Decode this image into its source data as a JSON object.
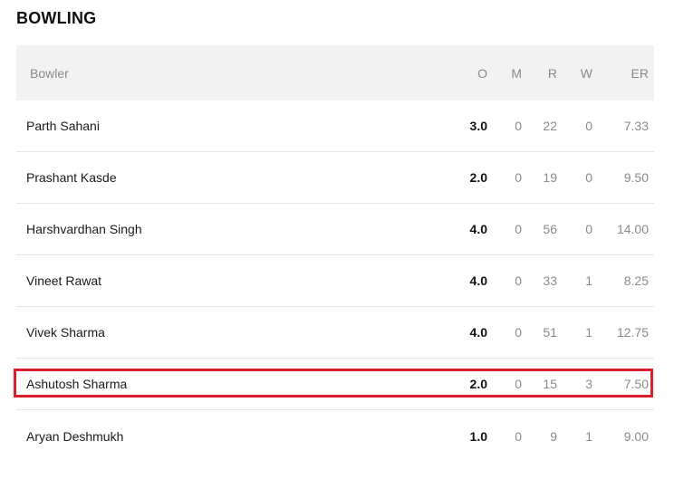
{
  "section": {
    "title": "BOWLING"
  },
  "columns": {
    "name": "Bowler",
    "o": "O",
    "m": "M",
    "r": "R",
    "w": "W",
    "er": "ER"
  },
  "rows": [
    {
      "name": "Parth Sahani",
      "o": "3.0",
      "m": "0",
      "r": "22",
      "w": "0",
      "er": "7.33"
    },
    {
      "name": "Prashant Kasde",
      "o": "2.0",
      "m": "0",
      "r": "19",
      "w": "0",
      "er": "9.50"
    },
    {
      "name": "Harshvardhan Singh",
      "o": "4.0",
      "m": "0",
      "r": "56",
      "w": "0",
      "er": "14.00"
    },
    {
      "name": "Vineet Rawat",
      "o": "4.0",
      "m": "0",
      "r": "33",
      "w": "1",
      "er": "8.25"
    },
    {
      "name": "Vivek Sharma",
      "o": "4.0",
      "m": "0",
      "r": "51",
      "w": "1",
      "er": "12.75"
    },
    {
      "name": "Ashutosh Sharma",
      "o": "2.0",
      "m": "0",
      "r": "15",
      "w": "3",
      "er": "7.50"
    },
    {
      "name": "Aryan Deshmukh",
      "o": "1.0",
      "m": "0",
      "r": "9",
      "w": "1",
      "er": "9.00"
    }
  ],
  "highlight": {
    "row_index": 5,
    "color": "#d9202a"
  }
}
